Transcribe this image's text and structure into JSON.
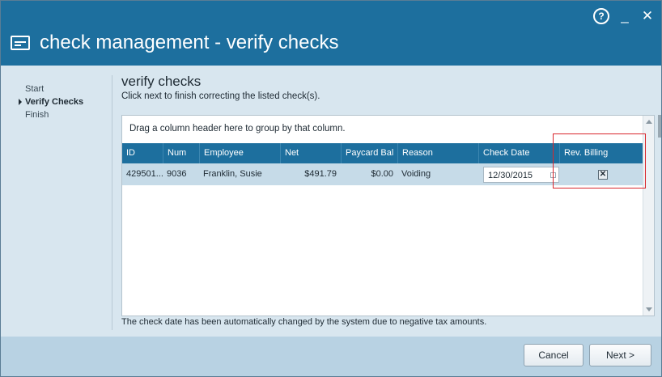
{
  "window": {
    "title": "check management - verify checks",
    "controls": {
      "help": "?",
      "minimize": "_",
      "close": "✕"
    }
  },
  "steps": [
    "Start",
    "Verify Checks",
    "Finish"
  ],
  "main": {
    "heading": "verify checks",
    "instruction": "Click next to finish correcting the listed check(s).",
    "note": "The check date has been automatically changed by the system due to negative tax amounts."
  },
  "grid": {
    "group_hint": "Drag a column header here to group by that column.",
    "columns": [
      "ID",
      "Num",
      "Employee",
      "Net",
      "Paycard Bal",
      "Reason",
      "Check Date",
      "Rev. Billing"
    ],
    "rows": [
      {
        "id": "429501...",
        "num": "9036",
        "employee": "Franklin, Susie",
        "net": "$491.79",
        "paycard_bal": "$0.00",
        "reason": "Voiding",
        "check_date": "12/30/2015",
        "rev_billing_checked": true,
        "rev_billing_mark": "✕"
      }
    ]
  },
  "buttons": {
    "cancel": "Cancel",
    "next": "Next >"
  },
  "colors": {
    "titlebar": "#1d6f9e",
    "header": "#1d6f9e",
    "row_selected": "#c6dbe8",
    "highlight": "#d9262c"
  }
}
